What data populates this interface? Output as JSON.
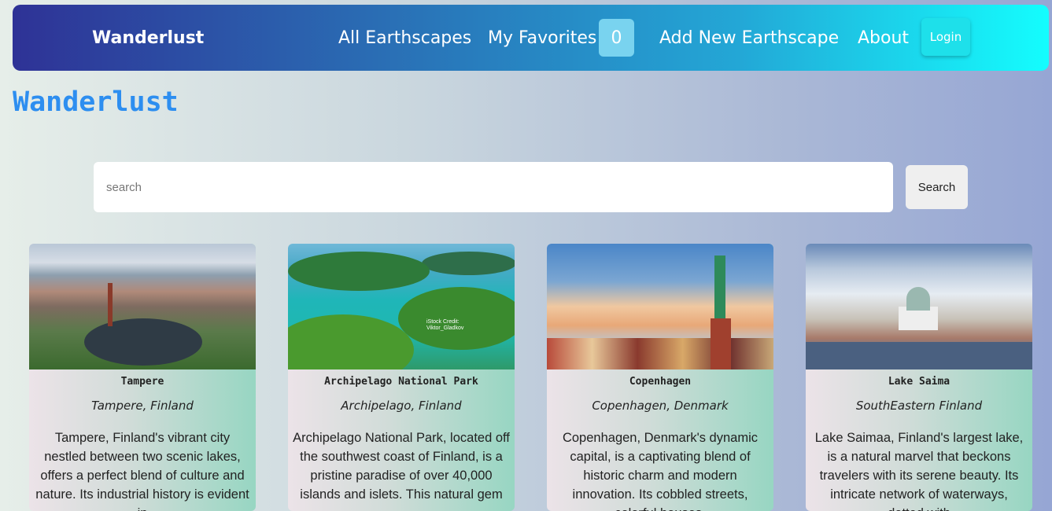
{
  "navbar": {
    "brand": "Wanderlust",
    "links": {
      "all": "All Earthscapes",
      "favorites": "My Favorites",
      "add": "Add New Earthscape",
      "about": "About"
    },
    "favorites_count": "0",
    "login_label": "Login"
  },
  "page": {
    "title": "Wanderlust"
  },
  "search": {
    "placeholder": "search",
    "button_label": "Search"
  },
  "cards": [
    {
      "name": "Tampere",
      "location": "Tampere, Finland",
      "description": "Tampere, Finland's vibrant city nestled between two scenic lakes, offers a perfect blend of culture and nature. Its industrial history is evident in"
    },
    {
      "name": "Archipelago National Park",
      "location": "Archipelago, Finland",
      "description": "Archipelago National Park, located off the southwest coast of Finland, is a pristine paradise of over 40,000 islands and islets. This natural gem",
      "image_watermark": "iStock Credit: Viktor_Gladkov"
    },
    {
      "name": "Copenhagen",
      "location": "Copenhagen, Denmark",
      "description": "Copenhagen, Denmark's dynamic capital, is a captivating blend of historic charm and modern innovation. Its cobbled streets, colorful houses,"
    },
    {
      "name": "Lake Saima",
      "location": "SouthEastern Finland",
      "description": "Lake Saimaa, Finland's largest lake, is a natural marvel that beckons travelers with its serene beauty. Its intricate network of waterways, dotted with"
    }
  ],
  "colors": {
    "nav_gradient_start": "#2e3296",
    "nav_gradient_end": "#14fdfe",
    "title_color": "#2d8ef0",
    "badge": "#79d3ef",
    "login_button": "#1ee0ea"
  }
}
